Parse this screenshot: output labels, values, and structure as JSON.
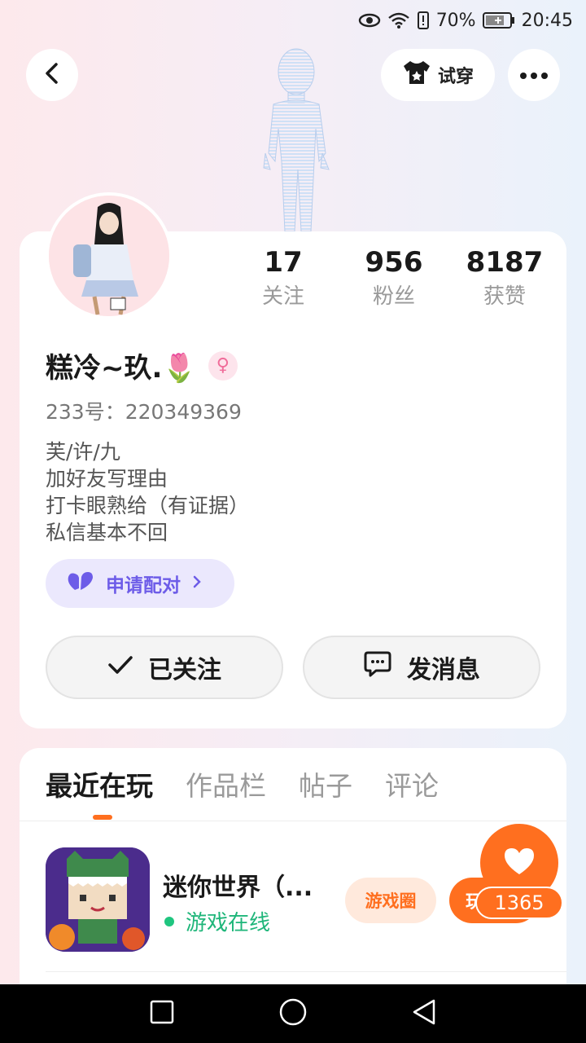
{
  "status_bar": {
    "battery_percent": "70%",
    "time": "20:45",
    "icons": [
      "eye-icon",
      "wifi-icon",
      "battery-alert-icon",
      "battery-icon"
    ]
  },
  "top_bar": {
    "tryon_label": "试穿",
    "icons": [
      "back-arrow-icon",
      "tshirt-icon",
      "more-icon"
    ]
  },
  "profile": {
    "stats": [
      {
        "value": "17",
        "label": "关注"
      },
      {
        "value": "956",
        "label": "粉丝"
      },
      {
        "value": "8187",
        "label": "获赞"
      }
    ],
    "nickname": "糕冷~玖.🌷",
    "gender_symbol": "♀",
    "uid": "233号：220349369",
    "bio_lines": [
      "芙/许/九",
      "加好友写理由",
      "打卡眼熟给（有证据）",
      "私信基本不回"
    ],
    "match_label": "申请配对",
    "follow_label": "已关注",
    "message_label": "发消息"
  },
  "tabs": [
    {
      "label": "最近在玩",
      "active": true
    },
    {
      "label": "作品栏",
      "active": false
    },
    {
      "label": "帖子",
      "active": false
    },
    {
      "label": "评论",
      "active": false
    }
  ],
  "games": [
    {
      "name": "迷你世界（...",
      "status": "游戏在线",
      "circle_label": "游戏圈",
      "play_label": "玩"
    }
  ],
  "like_count": "1365",
  "colors": {
    "accent": "#ff6f1f",
    "match_purple": "#6d5ce8",
    "online_green": "#1fb67a"
  }
}
